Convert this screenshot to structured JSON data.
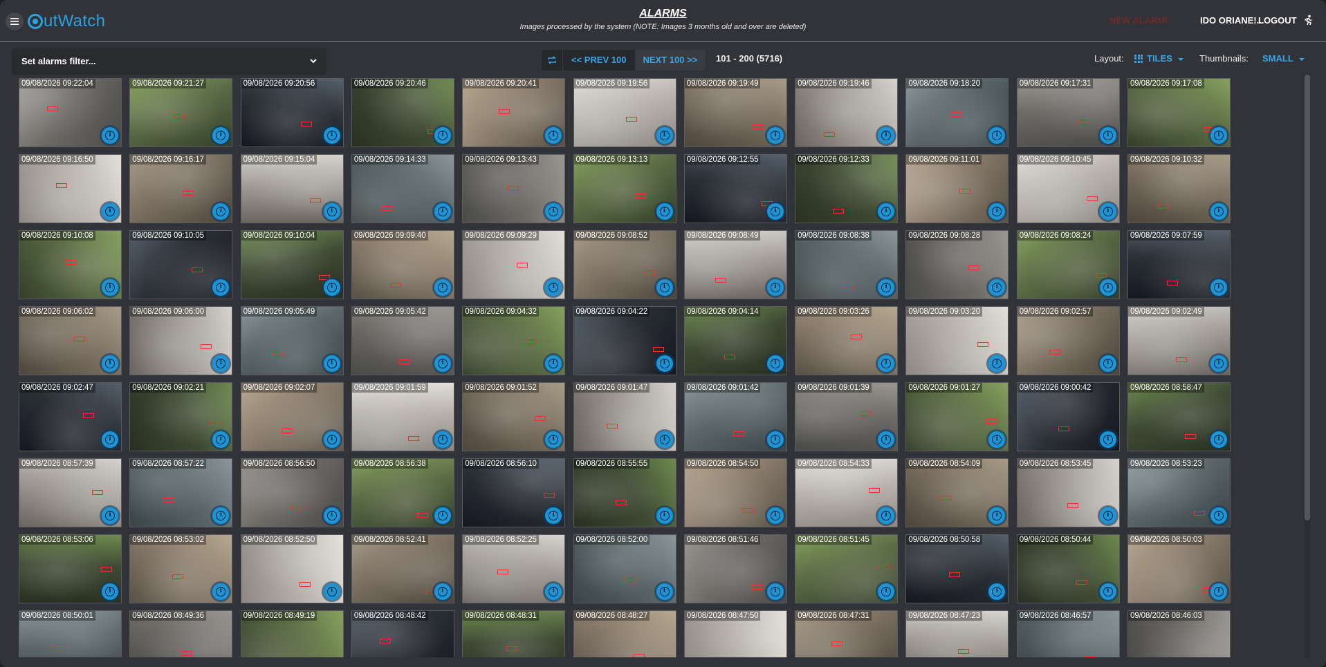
{
  "app": {
    "logo_text": "utWatch",
    "logo_icon": "eye-logo-icon"
  },
  "header": {
    "title": "ALARMS",
    "subtitle": "Images processed by the system (NOTE: Images 3 months old and over are deleted)",
    "new_alarm": "NEW ALARM!",
    "user": "IDO ORIANE!...",
    "logout": "LOGOUT",
    "menu_icon": "hamburger-menu-icon",
    "logout_icon": "running-person-icon"
  },
  "toolbar": {
    "filter_label": "Set alarms filter...",
    "prev": "<< PREV 100",
    "next": "NEXT 100 >>",
    "range": "101 - 200 (5716)",
    "layout_label": "Layout:",
    "layout_value": "TILES",
    "thumbnails_label": "Thumbnails:",
    "thumbnails_value": "SMALL"
  },
  "colors": {
    "accent": "#3aa6e6",
    "info_button": "#1c94d6",
    "background": "#323338",
    "new_alarm": "#6a2b2d"
  },
  "tiles": [
    "09/08/2026 09:22:04",
    "09/08/2026 09:21:27",
    "09/08/2026 09:20:56",
    "09/08/2026 09:20:46",
    "09/08/2026 09:20:41",
    "09/08/2026 09:19:56",
    "09/08/2026 09:19:49",
    "09/08/2026 09:19:46",
    "09/08/2026 09:18:20",
    "09/08/2026 09:17:31",
    "09/08/2026 09:17:08",
    "09/08/2026 09:16:50",
    "09/08/2026 09:16:17",
    "09/08/2026 09:15:04",
    "09/08/2026 09:14:33",
    "09/08/2026 09:13:43",
    "09/08/2026 09:13:13",
    "09/08/2026 09:12:55",
    "09/08/2026 09:12:33",
    "09/08/2026 09:11:01",
    "09/08/2026 09:10:45",
    "09/08/2026 09:10:32",
    "09/08/2026 09:10:08",
    "09/08/2026 09:10:05",
    "09/08/2026 09:10:04",
    "09/08/2026 09:09:40",
    "09/08/2026 09:09:29",
    "09/08/2026 09:08:52",
    "09/08/2026 09:08:49",
    "09/08/2026 09:08:38",
    "09/08/2026 09:08:28",
    "09/08/2026 09:08:24",
    "09/08/2026 09:07:59",
    "09/08/2026 09:06:02",
    "09/08/2026 09:06:00",
    "09/08/2026 09:05:49",
    "09/08/2026 09:05:42",
    "09/08/2026 09:04:32",
    "09/08/2026 09:04:22",
    "09/08/2026 09:04:14",
    "09/08/2026 09:03:26",
    "09/08/2026 09:03:20",
    "09/08/2026 09:02:57",
    "09/08/2026 09:02:49",
    "09/08/2026 09:02:47",
    "09/08/2026 09:02:21",
    "09/08/2026 09:02:07",
    "09/08/2026 09:01:59",
    "09/08/2026 09:01:52",
    "09/08/2026 09:01:47",
    "09/08/2026 09:01:42",
    "09/08/2026 09:01:39",
    "09/08/2026 09:01:27",
    "09/08/2026 09:00:42",
    "09/08/2026 08:58:47",
    "09/08/2026 08:57:39",
    "09/08/2026 08:57:22",
    "09/08/2026 08:56:50",
    "09/08/2026 08:56:38",
    "09/08/2026 08:56:10",
    "09/08/2026 08:55:55",
    "09/08/2026 08:54:50",
    "09/08/2026 08:54:33",
    "09/08/2026 08:54:09",
    "09/08/2026 08:53:45",
    "09/08/2026 08:53:23",
    "09/08/2026 08:53:06",
    "09/08/2026 08:53:02",
    "09/08/2026 08:52:50",
    "09/08/2026 08:52:41",
    "09/08/2026 08:52:25",
    "09/08/2026 08:52:00",
    "09/08/2026 08:51:46",
    "09/08/2026 08:51:45",
    "09/08/2026 08:50:58",
    "09/08/2026 08:50:44",
    "09/08/2026 08:50:03",
    "09/08/2026 08:50:01",
    "09/08/2026 08:49:36",
    "09/08/2026 08:49:19",
    "09/08/2026 08:48:42",
    "09/08/2026 08:48:31",
    "09/08/2026 08:48:27",
    "09/08/2026 08:47:50",
    "09/08/2026 08:47:31",
    "09/08/2026 08:47:23",
    "09/08/2026 08:46:57",
    "09/08/2026 08:46:03"
  ]
}
